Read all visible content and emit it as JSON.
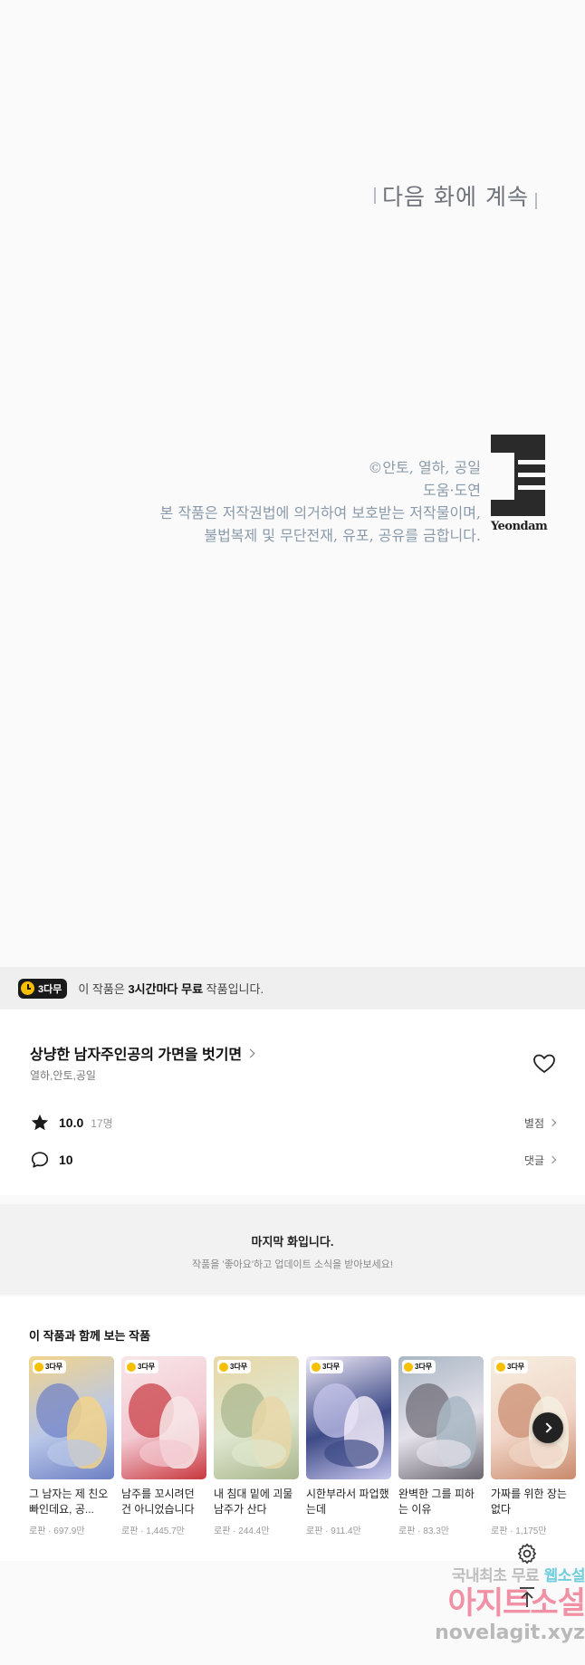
{
  "comic": {
    "continue_text": "다음 화에 계속",
    "credits": [
      "©안토, 열하, 공일",
      "도움·도연",
      "본 작품은 저작권법에 의거하여 보호받는 저작물이며,",
      "불법복제 및 무단전재, 유포, 공유를 금합니다."
    ],
    "publisher_logo_text": "Yeondam"
  },
  "free_banner": {
    "badge": "3다무",
    "message_prefix": "이 작품은 ",
    "message_bold": "3시간마다 무료",
    "message_suffix": " 작품입니다."
  },
  "work": {
    "title": "상냥한 남자주인공의 가면을 벗기면",
    "authors": "열하,안토,공일",
    "rating": "10.0",
    "rating_count": "17명",
    "rating_link": "별점",
    "comment_count": "10",
    "comment_link": "댓글"
  },
  "last_chapter": {
    "heading": "마지막 화입니다.",
    "sub": "작품을 '좋아요'하고 업데이트 소식을 받아보세요!"
  },
  "recommendations": {
    "title": "이 작품과 함께 보는 작품",
    "badge": "3다무",
    "items": [
      {
        "name": "그 남자는 제 친오빠인데요, 공...",
        "genre": "로판",
        "views": "697.9만",
        "colors": [
          "#b9c7e8",
          "#6d7fc4",
          "#f2d48a"
        ]
      },
      {
        "name": "남주를 꼬시려던 건 아니었습니다",
        "genre": "로판",
        "views": "1,445.7만",
        "colors": [
          "#f3c9d2",
          "#c8383e",
          "#f7e6e8"
        ]
      },
      {
        "name": "내 침대 밑에 괴물 남주가 산다",
        "genre": "로판",
        "views": "244.4만",
        "colors": [
          "#dfe7cf",
          "#a8b58c",
          "#e8d7a8"
        ]
      },
      {
        "name": "시한부라서 파업했는데",
        "genre": "로판",
        "views": "911.4만",
        "colors": [
          "#3d4a86",
          "#c9c8ee",
          "#efe9f7"
        ]
      },
      {
        "name": "완벽한 그를 피하는 이유",
        "genre": "로판",
        "views": "83.3만",
        "colors": [
          "#e4e1ea",
          "#6a6670",
          "#a9b7c4"
        ]
      },
      {
        "name": "가짜를 위한 장는 없다",
        "genre": "로판",
        "views": "1,175만",
        "colors": [
          "#f1d6c8",
          "#c98a6c",
          "#f5eee0"
        ]
      }
    ]
  },
  "watermark": {
    "line1_a": "국내최초 무료 ",
    "line1_b": "웹소설",
    "line2": "아지트소설",
    "line3": "novelagit.xyz"
  },
  "icons": {
    "heart": "heart-icon",
    "star": "star-icon",
    "comment": "comment-icon",
    "gear": "gear-icon",
    "top": "arrow-up-icon",
    "next": "chevron-right-icon"
  },
  "colors": {
    "badge_bg": "#1a1a1a",
    "clock_yellow": "#f6c000",
    "banner_bg": "#efefef"
  }
}
